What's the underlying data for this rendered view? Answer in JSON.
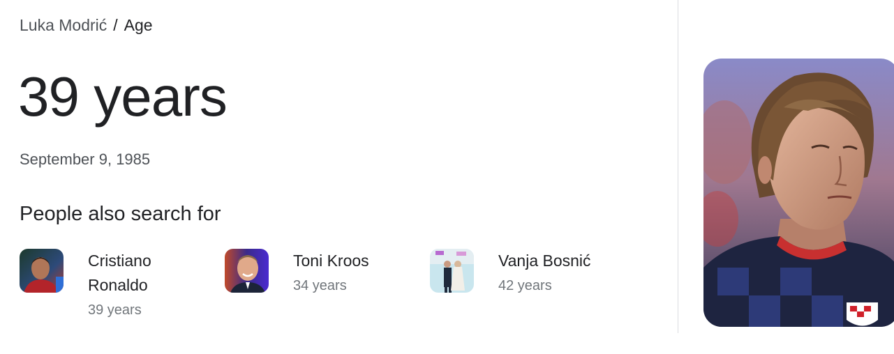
{
  "breadcrumb": {
    "parent": "Luka Modrić",
    "separator": "/",
    "current": "Age"
  },
  "answer": "39 years",
  "birthdate": "September 9, 1985",
  "people_also_search": {
    "heading": "People also search for",
    "people": [
      {
        "name_line1": "Cristiano",
        "name_line2": "Ronaldo",
        "age": "39 years"
      },
      {
        "name": "Toni Kroos",
        "age": "34 years"
      },
      {
        "name": "Vanja Bosnić",
        "age": "42 years"
      }
    ]
  }
}
